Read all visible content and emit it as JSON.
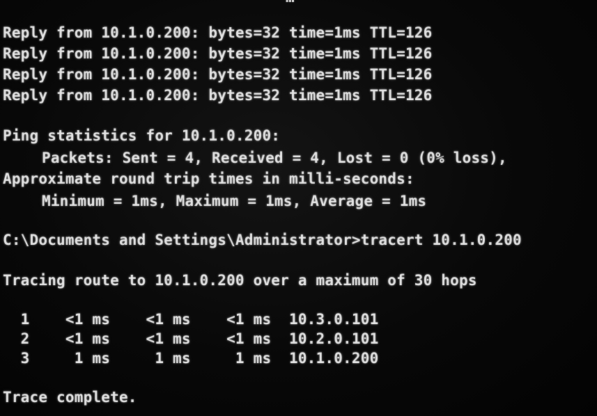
{
  "terminal": {
    "clipped_top_text": "…",
    "ping_replies": [
      "Reply from 10.1.0.200: bytes=32 time=1ms TTL=126",
      "Reply from 10.1.0.200: bytes=32 time=1ms TTL=126",
      "Reply from 10.1.0.200: bytes=32 time=1ms TTL=126",
      "Reply from 10.1.0.200: bytes=32 time=1ms TTL=126"
    ],
    "stats_header": "Ping statistics for 10.1.0.200:",
    "packets_line": "Packets: Sent = 4, Received = 4, Lost = 0 (0% loss),",
    "rtt_header": "Approximate round trip times in milli-seconds:",
    "rtt_values": "Minimum = 1ms, Maximum = 1ms, Average = 1ms",
    "prompt_command": "C:\\Documents and Settings\\Administrator>tracert 10.1.0.200",
    "tracing_header": "Tracing route to 10.1.0.200 over a maximum of 30 hops",
    "hops": [
      "  1    <1 ms    <1 ms    <1 ms  10.3.0.101",
      "  2    <1 ms    <1 ms    <1 ms  10.2.0.101",
      "  3     1 ms     1 ms     1 ms  10.1.0.200"
    ],
    "trace_complete": "Trace complete."
  }
}
